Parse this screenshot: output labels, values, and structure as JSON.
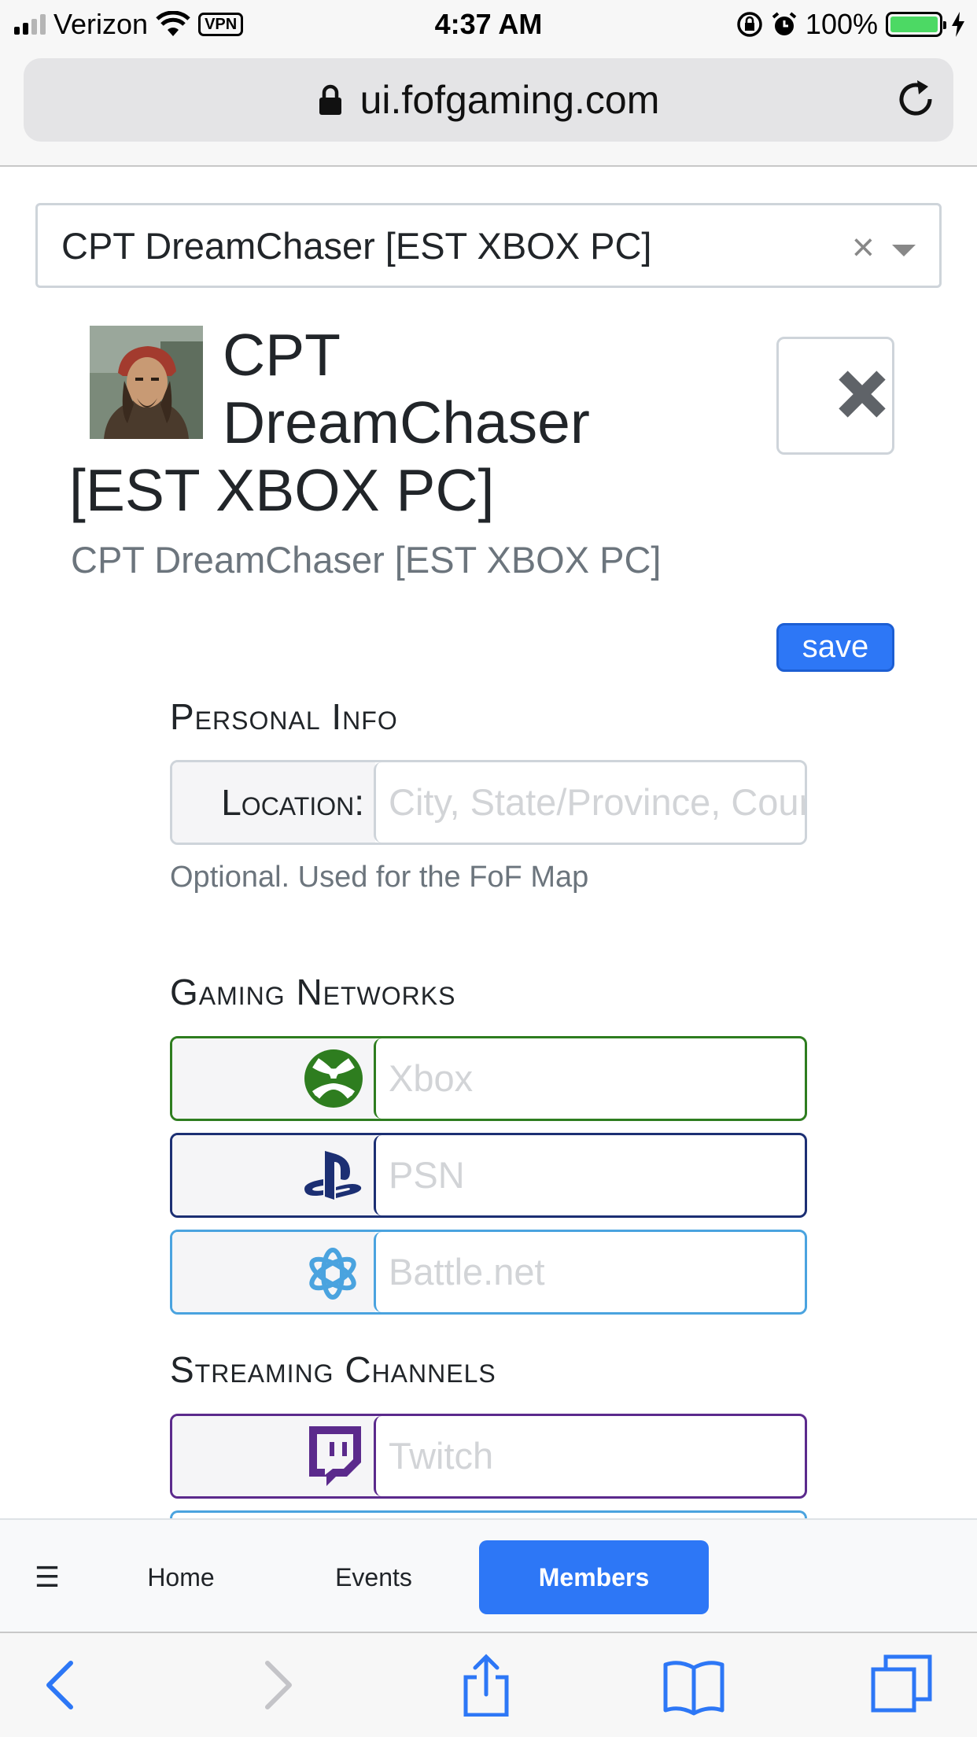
{
  "status_bar": {
    "carrier": "Verizon",
    "vpn": "VPN",
    "time": "4:37 AM",
    "battery": "100%"
  },
  "browser": {
    "url": "ui.fofgaming.com"
  },
  "member_select": {
    "value": "CPT DreamChaser [EST XBOX PC]",
    "clear": "×"
  },
  "profile": {
    "title_line1": "CPT",
    "title_line2": "DreamChaser",
    "title_line3": "[EST XBOX PC]",
    "subtitle": "CPT DreamChaser [EST XBOX PC]",
    "save_label": "save"
  },
  "personal_info": {
    "heading": "Personal Info",
    "location_label": "Location:",
    "location_placeholder": "City, State/Province, Country",
    "helper": "Optional. Used for the FoF Map"
  },
  "gaming_networks": {
    "heading": "Gaming Networks",
    "items": [
      {
        "placeholder": "Xbox",
        "color": "#2e7d1f",
        "icon": "xbox-icon"
      },
      {
        "placeholder": "PSN",
        "color": "#1c2f73",
        "icon": "playstation-icon"
      },
      {
        "placeholder": "Battle.net",
        "color": "#4aa3df",
        "icon": "battlenet-icon"
      }
    ]
  },
  "streaming_channels": {
    "heading": "Streaming Channels",
    "items": [
      {
        "placeholder": "Twitch",
        "color": "#5b2a8c",
        "icon": "twitch-icon"
      }
    ]
  },
  "app_nav": {
    "menu_icon": "☰",
    "items": [
      "Home",
      "Events",
      "Members"
    ],
    "active": "Members"
  }
}
